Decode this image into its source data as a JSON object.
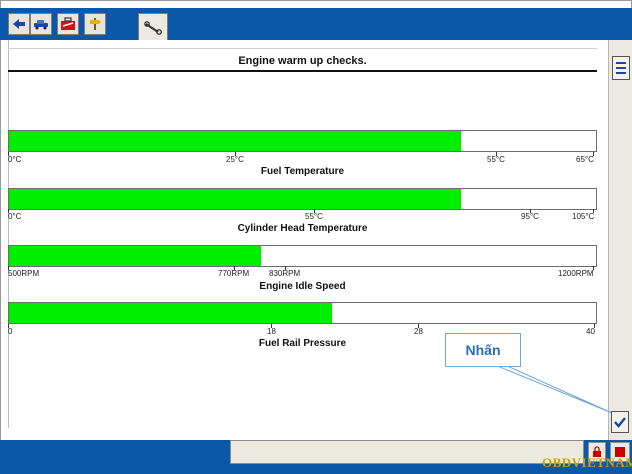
{
  "window": {
    "title": "Engine warm up checks."
  },
  "toolbar": {
    "buttons": [
      {
        "icon": "back-arrow-icon"
      },
      {
        "icon": "vehicle-icon"
      },
      {
        "icon": "toolbox-icon"
      },
      {
        "icon": "signpost-icon"
      }
    ],
    "active_tab_icon": "wrench-icon"
  },
  "gauges": [
    {
      "label": "Fuel Temperature",
      "fill_fraction": 0.77,
      "ticks": [
        "0°C",
        "25°C",
        "55°C",
        "65°C"
      ]
    },
    {
      "label": "Cylinder Head Temperature",
      "fill_fraction": 0.77,
      "ticks": [
        "0°C",
        "55°C",
        "95°C",
        "105°C"
      ]
    },
    {
      "label": "Engine Idle Speed",
      "fill_fraction": 0.43,
      "ticks": [
        "500RPM",
        "770RPM",
        "830RPM",
        "1200RPM"
      ]
    },
    {
      "label": "Fuel Rail Pressure",
      "fill_fraction": 0.55,
      "ticks": [
        "0",
        "18",
        "28",
        "40"
      ]
    }
  ],
  "callout": {
    "text": "Nhấn"
  },
  "side_buttons": {
    "list_icon": "list-icon",
    "confirm_icon": "checkmark-icon"
  },
  "footer": {
    "lock_icon": "lock-icon",
    "exit_icon": "red-square-icon"
  },
  "watermark": "OBDVIETNAM",
  "colors": {
    "accent_blue": "#0b58a8",
    "gauge_fill": "#00ee00",
    "callout_text": "#2a6fb5"
  }
}
